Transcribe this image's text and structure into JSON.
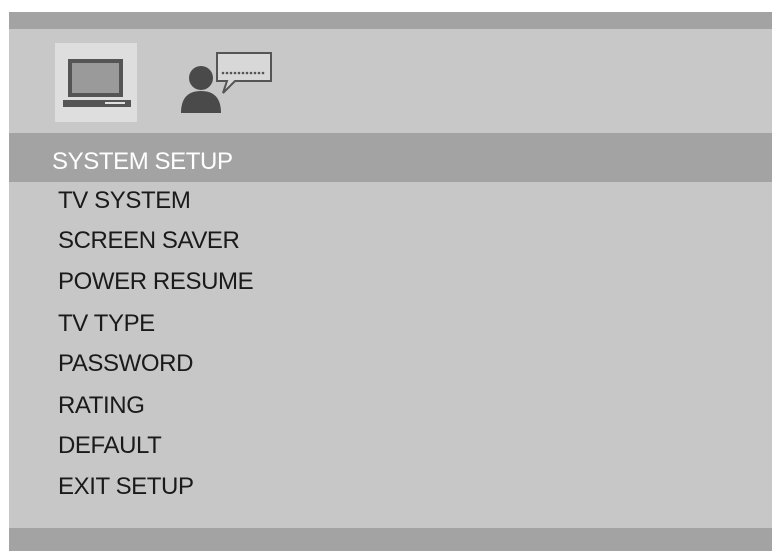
{
  "header": {
    "title": "SYSTEM SETUP"
  },
  "tabs": [
    {
      "icon": "tv-monitor-icon",
      "selected": true
    },
    {
      "icon": "user-speech-icon",
      "selected": false
    }
  ],
  "menu": {
    "items": [
      {
        "label": "TV SYSTEM"
      },
      {
        "label": "SCREEN SAVER"
      },
      {
        "label": "POWER RESUME"
      },
      {
        "label": "TV TYPE"
      },
      {
        "label": "PASSWORD"
      },
      {
        "label": "RATING"
      },
      {
        "label": "DEFAULT"
      },
      {
        "label": "EXIT SETUP"
      }
    ]
  },
  "colors": {
    "frame": "#a3a3a3",
    "panel": "#c7c7c7",
    "header_text": "#ffffff",
    "item_text": "#1a1a1a"
  }
}
